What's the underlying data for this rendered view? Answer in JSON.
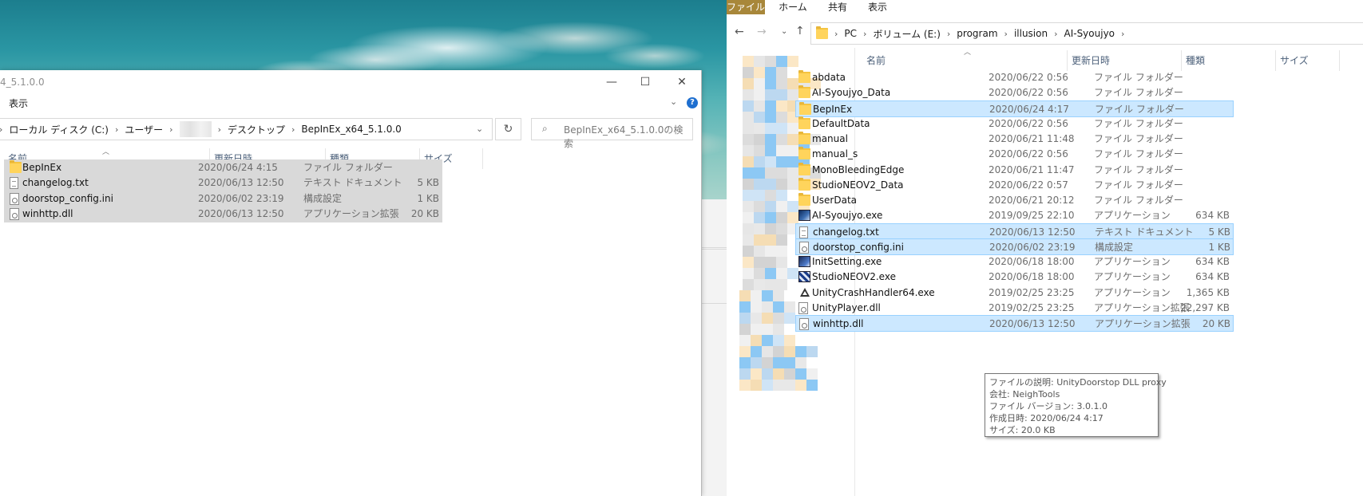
{
  "left_window": {
    "title": "4_5.1.0.0",
    "menu": {
      "view_label": "表示"
    },
    "window_controls": {
      "minimize": "—",
      "maximize": "☐",
      "close": "✕"
    },
    "address": {
      "crumbs": [
        "ローカル ディスク (C:)",
        "ユーザー",
        "",
        "デスクトップ",
        "BepInEx_x64_5.1.0.0"
      ]
    },
    "search": {
      "placeholder": "BepInEx_x64_5.1.0.0の検索"
    },
    "columns": {
      "name": "名前",
      "date": "更新日時",
      "type": "種類",
      "size": "サイズ"
    },
    "rows": [
      {
        "name": "BepInEx",
        "date": "2020/06/24 4:15",
        "type": "ファイル フォルダー",
        "size": "",
        "icon": "folder-icon"
      },
      {
        "name": "changelog.txt",
        "date": "2020/06/13 12:50",
        "type": "テキスト ドキュメント",
        "size": "5 KB",
        "icon": "text-file-icon"
      },
      {
        "name": "doorstop_config.ini",
        "date": "2020/06/02 23:19",
        "type": "構成設定",
        "size": "1 KB",
        "icon": "config-file-icon"
      },
      {
        "name": "winhttp.dll",
        "date": "2020/06/13 12:50",
        "type": "アプリケーション拡張",
        "size": "20 KB",
        "icon": "dll-file-icon"
      }
    ]
  },
  "right_window": {
    "ribbon_tabs": [
      "ファイル",
      "ホーム",
      "共有",
      "表示"
    ],
    "address": {
      "crumbs": [
        "PC",
        "ボリューム (E:)",
        "program",
        "illusion",
        "AI-Syoujyo"
      ]
    },
    "columns": {
      "name": "名前",
      "date": "更新日時",
      "type": "種類",
      "size": "サイズ"
    },
    "rows": [
      {
        "name": "abdata",
        "date": "2020/06/22 0:56",
        "type": "ファイル フォルダー",
        "size": "",
        "icon": "folder-icon",
        "selected": false
      },
      {
        "name": "AI-Syoujyo_Data",
        "date": "2020/06/22 0:56",
        "type": "ファイル フォルダー",
        "size": "",
        "icon": "folder-icon",
        "selected": false
      },
      {
        "name": "BepInEx",
        "date": "2020/06/24 4:17",
        "type": "ファイル フォルダー",
        "size": "",
        "icon": "folder-icon",
        "selected": true
      },
      {
        "name": "DefaultData",
        "date": "2020/06/22 0:56",
        "type": "ファイル フォルダー",
        "size": "",
        "icon": "folder-icon",
        "selected": false
      },
      {
        "name": "manual",
        "date": "2020/06/21 11:48",
        "type": "ファイル フォルダー",
        "size": "",
        "icon": "folder-icon",
        "selected": false
      },
      {
        "name": "manual_s",
        "date": "2020/06/22 0:56",
        "type": "ファイル フォルダー",
        "size": "",
        "icon": "folder-icon",
        "selected": false
      },
      {
        "name": "MonoBleedingEdge",
        "date": "2020/06/21 11:47",
        "type": "ファイル フォルダー",
        "size": "",
        "icon": "folder-icon",
        "selected": false
      },
      {
        "name": "StudioNEOV2_Data",
        "date": "2020/06/22 0:57",
        "type": "ファイル フォルダー",
        "size": "",
        "icon": "folder-icon",
        "selected": false
      },
      {
        "name": "UserData",
        "date": "2020/06/21 20:12",
        "type": "ファイル フォルダー",
        "size": "",
        "icon": "folder-icon",
        "selected": false
      },
      {
        "name": "AI-Syoujyo.exe",
        "date": "2019/09/25 22:10",
        "type": "アプリケーション",
        "size": "634 KB",
        "icon": "ai-syoujyo-app-icon",
        "selected": false
      },
      {
        "name": "changelog.txt",
        "date": "2020/06/13 12:50",
        "type": "テキスト ドキュメント",
        "size": "5 KB",
        "icon": "text-file-icon",
        "selected": true
      },
      {
        "name": "doorstop_config.ini",
        "date": "2020/06/02 23:19",
        "type": "構成設定",
        "size": "1 KB",
        "icon": "config-file-icon",
        "selected": true
      },
      {
        "name": "InitSetting.exe",
        "date": "2020/06/18 18:00",
        "type": "アプリケーション",
        "size": "634 KB",
        "icon": "init-setting-app-icon",
        "selected": false
      },
      {
        "name": "StudioNEOV2.exe",
        "date": "2020/06/18 18:00",
        "type": "アプリケーション",
        "size": "634 KB",
        "icon": "studio-app-icon",
        "selected": false
      },
      {
        "name": "UnityCrashHandler64.exe",
        "date": "2019/02/25 23:25",
        "type": "アプリケーション",
        "size": "1,365 KB",
        "icon": "unity-icon",
        "selected": false
      },
      {
        "name": "UnityPlayer.dll",
        "date": "2019/02/25 23:25",
        "type": "アプリケーション拡張",
        "size": "22,297 KB",
        "icon": "dll-file-icon",
        "selected": false
      },
      {
        "name": "winhttp.dll",
        "date": "2020/06/13 12:50",
        "type": "アプリケーション拡張",
        "size": "20 KB",
        "icon": "dll-file-icon",
        "selected": true
      }
    ]
  },
  "tooltip": {
    "lines": [
      "ファイルの説明: UnityDoorstop DLL proxy",
      "会社: NeighTools",
      "ファイル バージョン: 3.0.1.0",
      "作成日時: 2020/06/24 4:17",
      "サイズ: 20.0 KB"
    ]
  },
  "colors": {
    "selection_gray": "#d9d9d9",
    "selection_blue": "#cce8ff",
    "selection_blue_border": "#99d1ff",
    "ribbon_file_tab": "#a8873a",
    "folder": "#ffd45c",
    "header_text": "#4c607a"
  }
}
